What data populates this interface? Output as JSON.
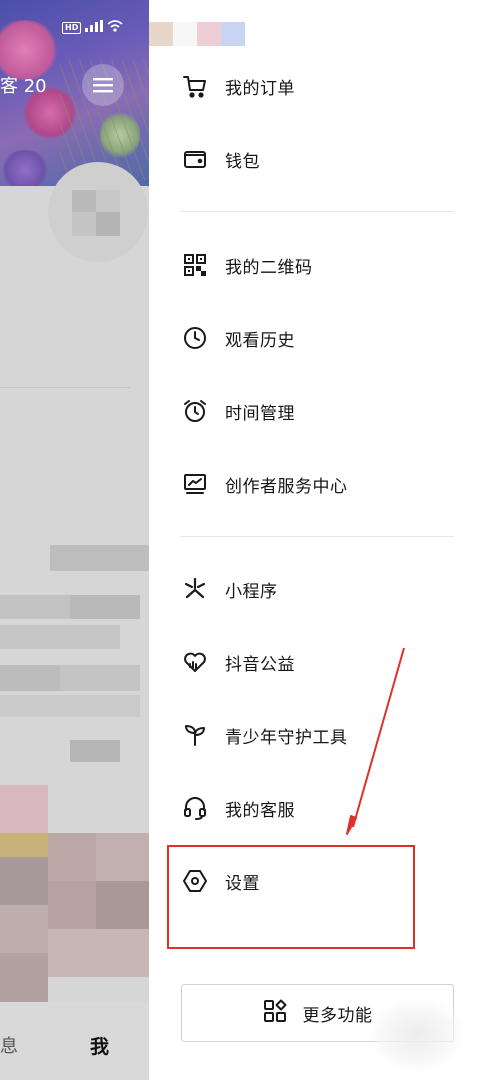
{
  "background": {
    "visitor_label": "客 20",
    "nav": {
      "messages_label": "息",
      "me_label": "我"
    }
  },
  "drawer": {
    "items": [
      {
        "label": "我的订单",
        "icon": "cart-icon"
      },
      {
        "label": "钱包",
        "icon": "wallet-icon"
      },
      {
        "label": "我的二维码",
        "icon": "qr-code-icon"
      },
      {
        "label": "观看历史",
        "icon": "clock-icon"
      },
      {
        "label": "时间管理",
        "icon": "alarm-clock-icon"
      },
      {
        "label": "创作者服务中心",
        "icon": "creator-chart-icon"
      },
      {
        "label": "小程序",
        "icon": "mini-program-icon"
      },
      {
        "label": "抖音公益",
        "icon": "charity-heart-icon"
      },
      {
        "label": "青少年守护工具",
        "icon": "sprout-icon"
      },
      {
        "label": "我的客服",
        "icon": "headset-icon"
      },
      {
        "label": "设置",
        "icon": "settings-hexagon-icon"
      }
    ],
    "more_button": {
      "label": "更多功能",
      "icon": "more-functions-icon"
    }
  },
  "colors": {
    "annotation_red": "#e0302a",
    "text": "#161616",
    "divider": "#e6e6e6"
  }
}
